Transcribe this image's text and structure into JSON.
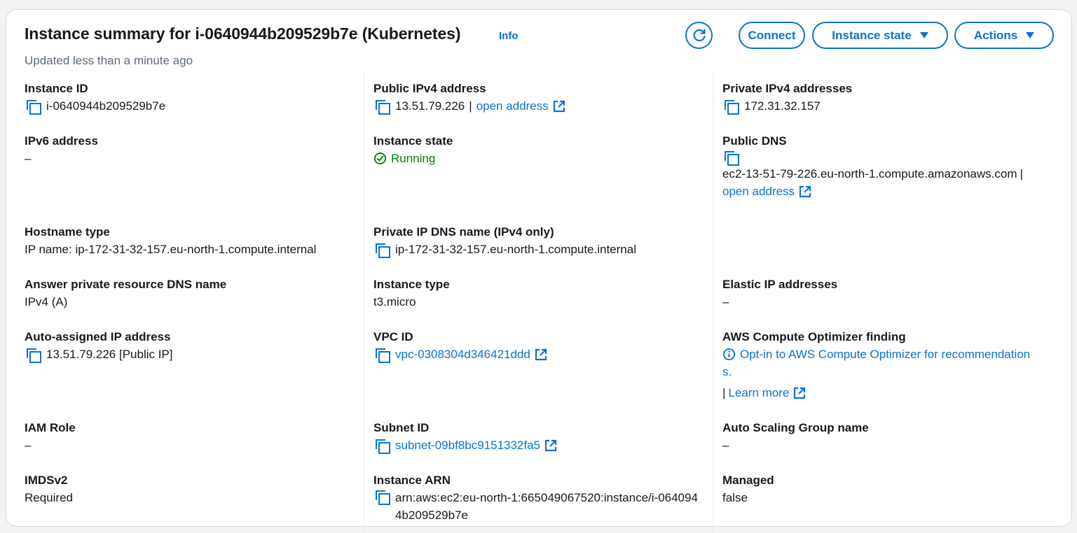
{
  "header": {
    "title": "Instance summary for i-0640944b209529b7e (Kubernetes)",
    "info": "Info",
    "updated": "Updated less than a minute ago",
    "buttons": {
      "connect": "Connect",
      "instance_state": "Instance state",
      "actions": "Actions"
    }
  },
  "fields": {
    "instance_id": {
      "label": "Instance ID",
      "value": "i-0640944b209529b7e"
    },
    "public_ipv4": {
      "label": "Public IPv4 address",
      "value": "13.51.79.226",
      "separator": "|",
      "link": "open address"
    },
    "private_ipv4": {
      "label": "Private IPv4 addresses",
      "value": "172.31.32.157"
    },
    "ipv6": {
      "label": "IPv6 address",
      "value": "–"
    },
    "instance_state": {
      "label": "Instance state",
      "value": "Running"
    },
    "public_dns": {
      "label": "Public DNS",
      "value": "ec2-13-51-79-226.eu-north-1.compute.amazonaws.com",
      "separator": "|",
      "link": "open address"
    },
    "hostname_type": {
      "label": "Hostname type",
      "value": "IP name: ip-172-31-32-157.eu-north-1.compute.internal"
    },
    "private_dns": {
      "label": "Private IP DNS name (IPv4 only)",
      "value": "ip-172-31-32-157.eu-north-1.compute.internal"
    },
    "answer_dns": {
      "label": "Answer private resource DNS name",
      "value": "IPv4 (A)"
    },
    "instance_type": {
      "label": "Instance type",
      "value": "t3.micro"
    },
    "elastic_ip": {
      "label": "Elastic IP addresses",
      "value": "–"
    },
    "auto_ip": {
      "label": "Auto-assigned IP address",
      "value": "13.51.79.226 [Public IP]"
    },
    "vpc_id": {
      "label": "VPC ID",
      "value": "vpc-0308304d346421ddd"
    },
    "optimizer": {
      "label": "AWS Compute Optimizer finding",
      "line1": "Opt-in to AWS Compute Optimizer for recommendation",
      "line2": "s.",
      "separator": "|",
      "link": "Learn more"
    },
    "iam_role": {
      "label": "IAM Role",
      "value": "–"
    },
    "subnet_id": {
      "label": "Subnet ID",
      "value": "subnet-09bf8bc9151332fa5"
    },
    "asg_name": {
      "label": "Auto Scaling Group name",
      "value": "–"
    },
    "imdsv2": {
      "label": "IMDSv2",
      "value": "Required"
    },
    "instance_arn": {
      "label": "Instance ARN",
      "value": "arn:aws:ec2:eu-north-1:665049067520:instance/i-0640944b209529b7e"
    },
    "managed": {
      "label": "Managed",
      "value": "false"
    }
  },
  "colors": {
    "link": "#0972d3",
    "success": "#037f0c",
    "text": "#16191f",
    "muted": "#5f6b7a"
  }
}
